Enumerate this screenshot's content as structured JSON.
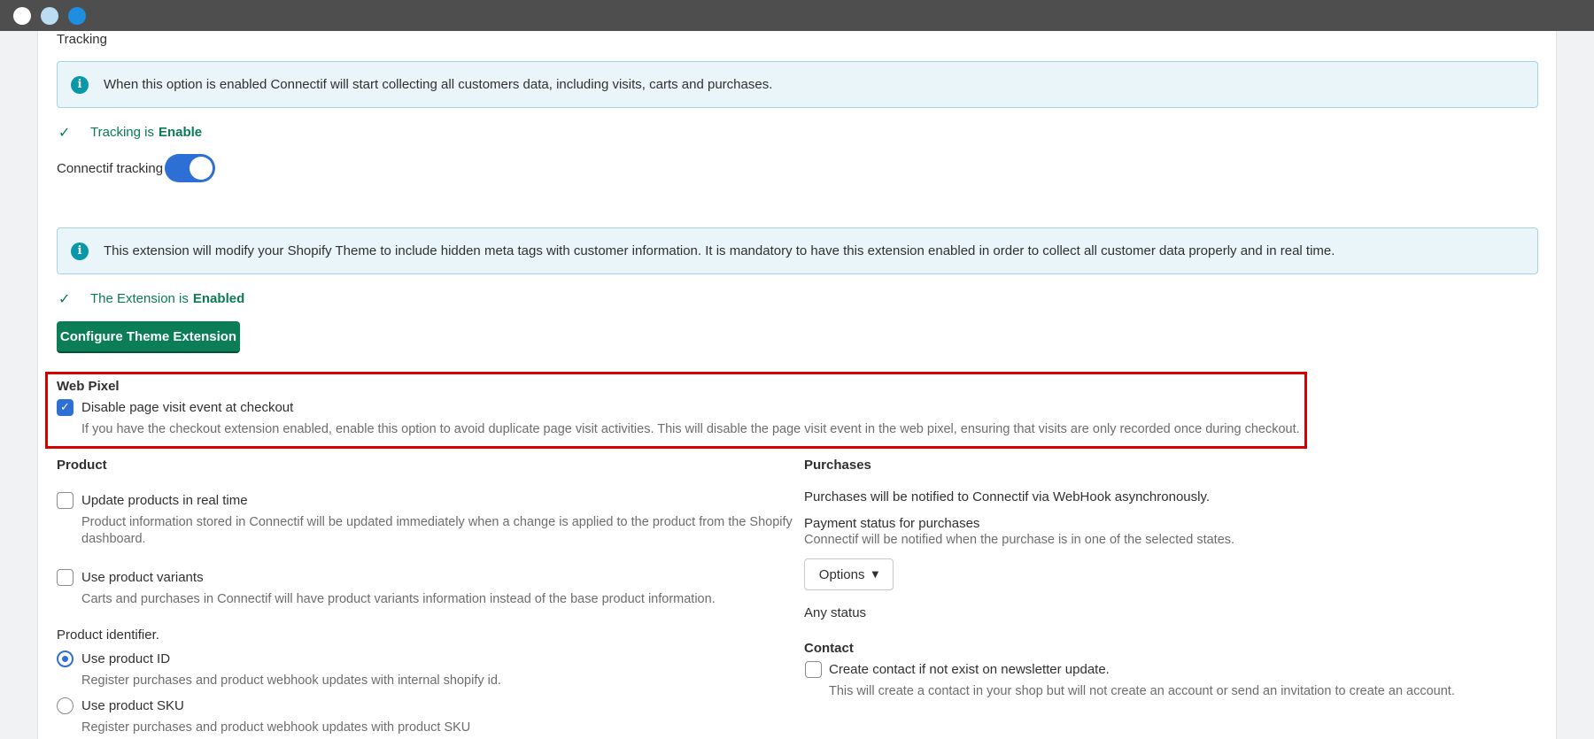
{
  "tracking": {
    "heading": "Tracking",
    "banner_text": "When this option is enabled Connectif will start collecting all customers data, including visits, carts and purchases.",
    "status_prefix": "Tracking is",
    "status_value": "Enable",
    "toggle_label": "Connectif tracking",
    "toggle_on": true
  },
  "theme_extension": {
    "banner_text": "This extension will modify your Shopify Theme to include hidden meta tags with customer information. It is mandatory to have this extension enabled in order to collect all customer data properly and in real time.",
    "status_prefix": "The Extension is",
    "status_value": "Enabled",
    "configure_button": "Configure Theme Extension"
  },
  "web_pixel": {
    "heading": "Web Pixel",
    "checkbox_label": "Disable page visit event at checkout",
    "checked": true,
    "help": "If you have the checkout extension enabled, enable this option to avoid duplicate page visit activities. This will disable the page visit event in the web pixel, ensuring that visits are only recorded once during checkout."
  },
  "product": {
    "heading": "Product",
    "update_realtime": {
      "label": "Update products in real time",
      "help_line1": "Product information stored in Connectif will be updated immediately when a change is applied to the product from the Shopify",
      "help_line2": "dashboard.",
      "checked": false
    },
    "variants": {
      "label": "Use product variants",
      "help": "Carts and purchases in Connectif will have product variants information instead of the base product information.",
      "checked": false
    },
    "identifier_label": "Product identifier.",
    "use_id": {
      "label": "Use product ID",
      "help": "Register purchases and product webhook updates with internal shopify id.",
      "selected": true
    },
    "use_sku": {
      "label": "Use product SKU",
      "help": "Register purchases and product webhook updates with product SKU",
      "selected": false
    }
  },
  "purchases": {
    "heading": "Purchases",
    "description": "Purchases will be notified to Connectif via WebHook asynchronously.",
    "payment_status_label": "Payment status for purchases",
    "payment_status_help": "Connectif will be notified when the purchase is in one of the selected states.",
    "options_button": "Options",
    "selected_status": "Any status"
  },
  "contact": {
    "heading": "Contact",
    "checkbox_label": "Create contact if not exist on newsletter update.",
    "help": "This will create a contact in your shop but will not create an account or send an invitation to create an account.",
    "checked": false
  },
  "colors": {
    "accent_blue": "#2e6fd6",
    "success_green": "#0b7a55",
    "button_green": "#0b7e58",
    "info_bg": "#eaf5fa",
    "highlight_red": "#d60000"
  }
}
